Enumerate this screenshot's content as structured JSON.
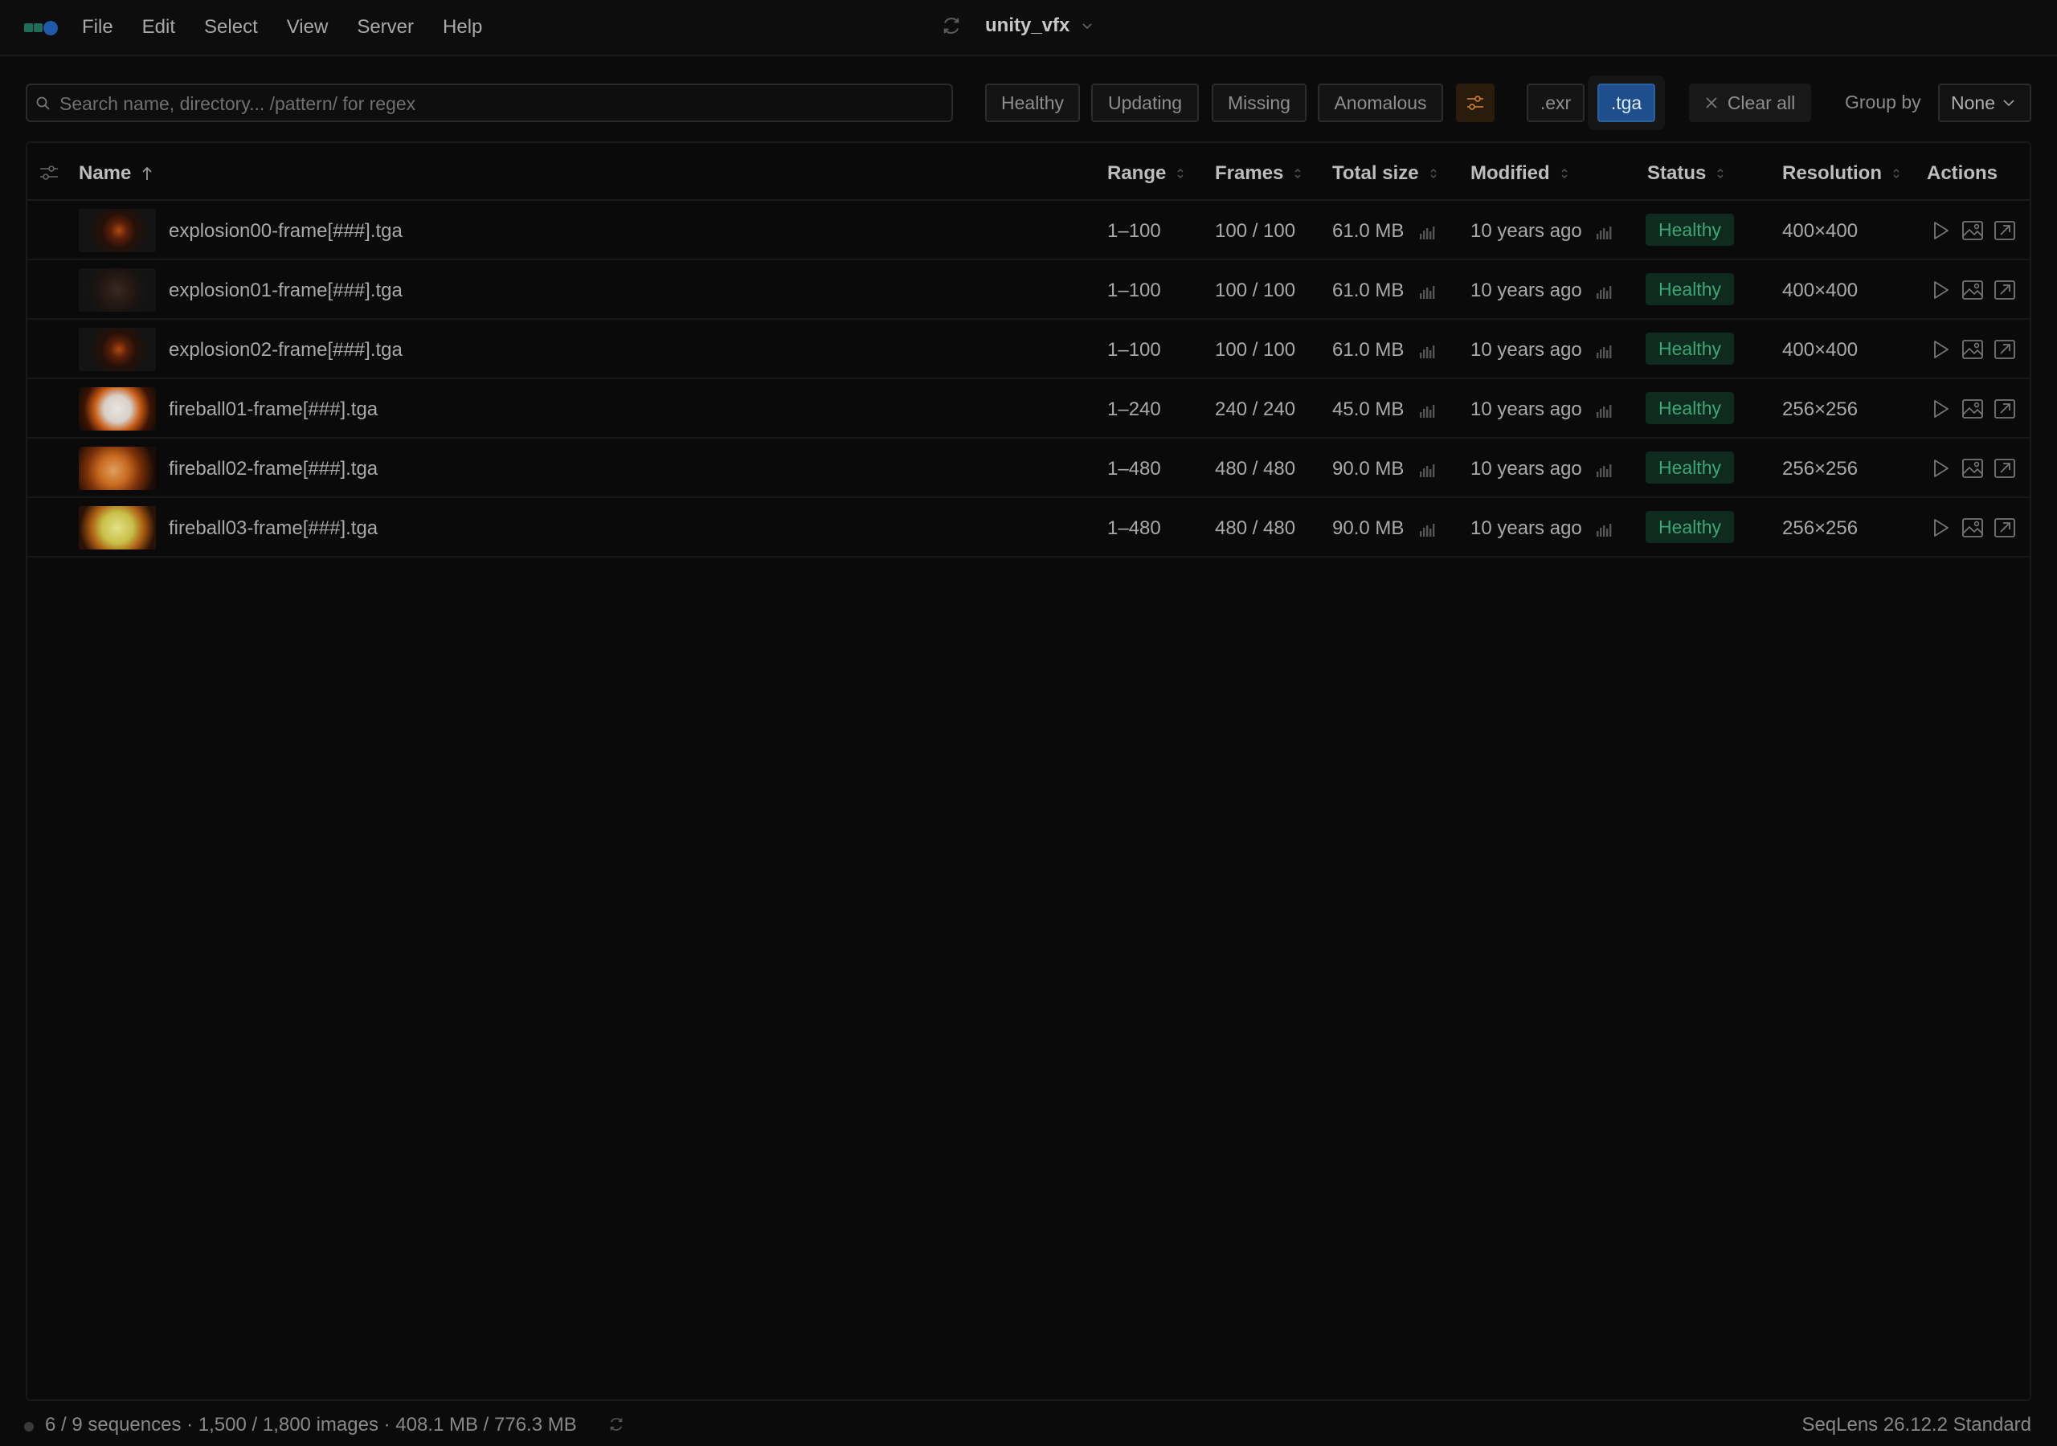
{
  "menubar": {
    "items": [
      "File",
      "Edit",
      "Select",
      "View",
      "Server",
      "Help"
    ],
    "project_title": "unity_vfx"
  },
  "toolbar": {
    "search_placeholder": "Search name, directory... /pattern/ for regex",
    "status_filters": [
      "Healthy",
      "Updating",
      "Missing",
      "Anomalous"
    ],
    "ext_filters": [
      ".exr",
      ".tga"
    ],
    "active_ext": ".tga",
    "clear_label": "Clear all",
    "group_by_label": "Group by",
    "group_by_value": "None"
  },
  "table": {
    "columns": {
      "name": "Name",
      "range": "Range",
      "frames": "Frames",
      "total_size": "Total size",
      "modified": "Modified",
      "status": "Status",
      "resolution": "Resolution",
      "actions": "Actions"
    },
    "rows": [
      {
        "name": "explosion00-frame[###].tga",
        "range": "1–100",
        "frames": "100 / 100",
        "size": "61.0 MB",
        "modified": "10 years ago",
        "status": "Healthy",
        "resolution": "400×400",
        "thumb": "explosion-dark"
      },
      {
        "name": "explosion01-frame[###].tga",
        "range": "1–100",
        "frames": "100 / 100",
        "size": "61.0 MB",
        "modified": "10 years ago",
        "status": "Healthy",
        "resolution": "400×400",
        "thumb": "explosion-smoke"
      },
      {
        "name": "explosion02-frame[###].tga",
        "range": "1–100",
        "frames": "100 / 100",
        "size": "61.0 MB",
        "modified": "10 years ago",
        "status": "Healthy",
        "resolution": "400×400",
        "thumb": "explosion-dark"
      },
      {
        "name": "fireball01-frame[###].tga",
        "range": "1–240",
        "frames": "240 / 240",
        "size": "45.0 MB",
        "modified": "10 years ago",
        "status": "Healthy",
        "resolution": "256×256",
        "thumb": "fireball-white"
      },
      {
        "name": "fireball02-frame[###].tga",
        "range": "1–480",
        "frames": "480 / 480",
        "size": "90.0 MB",
        "modified": "10 years ago",
        "status": "Healthy",
        "resolution": "256×256",
        "thumb": "fireball-orange"
      },
      {
        "name": "fireball03-frame[###].tga",
        "range": "1–480",
        "frames": "480 / 480",
        "size": "90.0 MB",
        "modified": "10 years ago",
        "status": "Healthy",
        "resolution": "256×256",
        "thumb": "fireball-yellow"
      }
    ]
  },
  "statusbar": {
    "summary": "6 / 9 sequences · 1,500 / 1,800 images · 408.1 MB / 776.3 MB",
    "version": "SeqLens 26.12.2 Standard"
  },
  "colors": {
    "accent": "#1e4f8c",
    "healthy_bg": "#0f2a1e",
    "healthy_text": "#3aa874",
    "filter_icon": "#c47a2a"
  }
}
